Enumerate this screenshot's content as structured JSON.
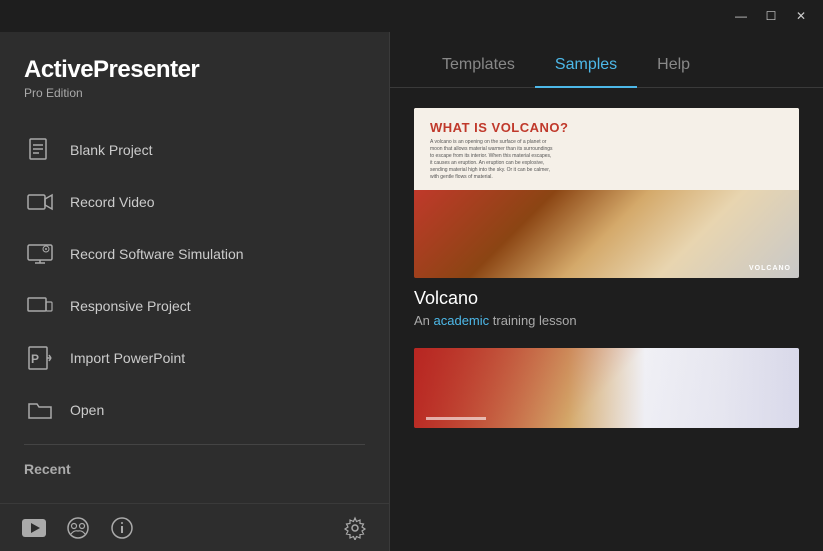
{
  "titlebar": {
    "minimize_label": "—",
    "maximize_label": "☐",
    "close_label": "✕"
  },
  "sidebar": {
    "app_name": "ActivePresenter",
    "edition": "Pro Edition",
    "menu_items": [
      {
        "id": "blank-project",
        "label": "Blank Project"
      },
      {
        "id": "record-video",
        "label": "Record Video"
      },
      {
        "id": "record-simulation",
        "label": "Record Software Simulation"
      },
      {
        "id": "responsive-project",
        "label": "Responsive Project"
      },
      {
        "id": "import-powerpoint",
        "label": "Import PowerPoint"
      },
      {
        "id": "open",
        "label": "Open"
      }
    ],
    "recent_label": "Recent"
  },
  "tabs": [
    {
      "id": "templates",
      "label": "Templates",
      "active": false
    },
    {
      "id": "samples",
      "label": "Samples",
      "active": true
    },
    {
      "id": "help",
      "label": "Help",
      "active": false
    }
  ],
  "samples": [
    {
      "id": "volcano",
      "name": "Volcano",
      "description": "An academic training lesson",
      "description_highlight": "academic",
      "thumb_label": "VOLCANO"
    },
    {
      "id": "sample2",
      "name": "",
      "description": ""
    }
  ],
  "footer_icons": [
    {
      "id": "youtube",
      "label": "YouTube"
    },
    {
      "id": "community",
      "label": "Community"
    },
    {
      "id": "info",
      "label": "Info"
    },
    {
      "id": "settings",
      "label": "Settings"
    }
  ]
}
